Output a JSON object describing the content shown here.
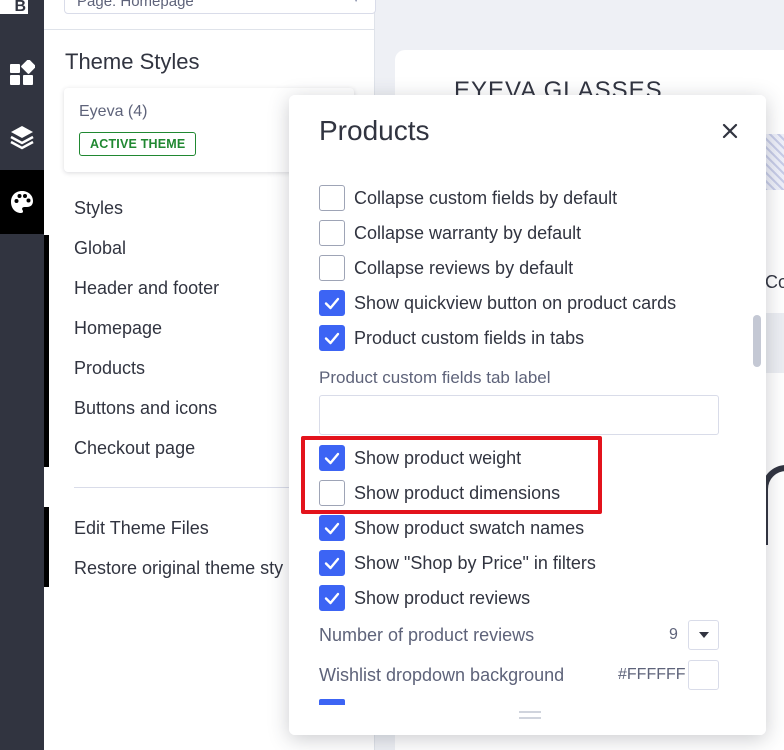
{
  "page_select": {
    "value": "Page: Homepage"
  },
  "rail": {
    "logo": "B"
  },
  "sidebar": {
    "title": "Theme Styles",
    "theme": {
      "name": "Eyeva (4)",
      "badge": "ACTIVE THEME"
    },
    "menu": [
      "Styles",
      "Global",
      "Header and footer",
      "Homepage",
      "Products",
      "Buttons and icons",
      "Checkout page"
    ],
    "menu2": [
      "Edit Theme Files",
      "Restore original theme sty"
    ]
  },
  "preview": {
    "brand": "EYEVA GLASSES",
    "partial_text": "Co"
  },
  "modal": {
    "title": "Products",
    "checkboxes_top": [
      {
        "label": "Collapse custom fields by default",
        "checked": false
      },
      {
        "label": "Collapse warranty by default",
        "checked": false
      },
      {
        "label": "Collapse reviews by default",
        "checked": false
      },
      {
        "label": "Show quickview button on product cards",
        "checked": true
      },
      {
        "label": "Product custom fields in tabs",
        "checked": true
      }
    ],
    "tab_label": {
      "label": "Product custom fields tab label",
      "value": ""
    },
    "checkboxes_bottom": [
      {
        "label": "Show product weight",
        "checked": true
      },
      {
        "label": "Show product dimensions",
        "checked": false
      },
      {
        "label": "Show product swatch names",
        "checked": true
      },
      {
        "label": "Show \"Shop by Price\" in filters",
        "checked": true
      },
      {
        "label": "Show product reviews",
        "checked": true
      }
    ],
    "reviews_count": {
      "label": "Number of product reviews",
      "value": "9"
    },
    "wishlist_bg": {
      "label": "Wishlist dropdown background",
      "value": "#FFFFFF"
    }
  },
  "colors": {
    "accent": "#3c64f4",
    "rail": "#313440",
    "highlight": "#e3131c",
    "badge": "#208831"
  }
}
